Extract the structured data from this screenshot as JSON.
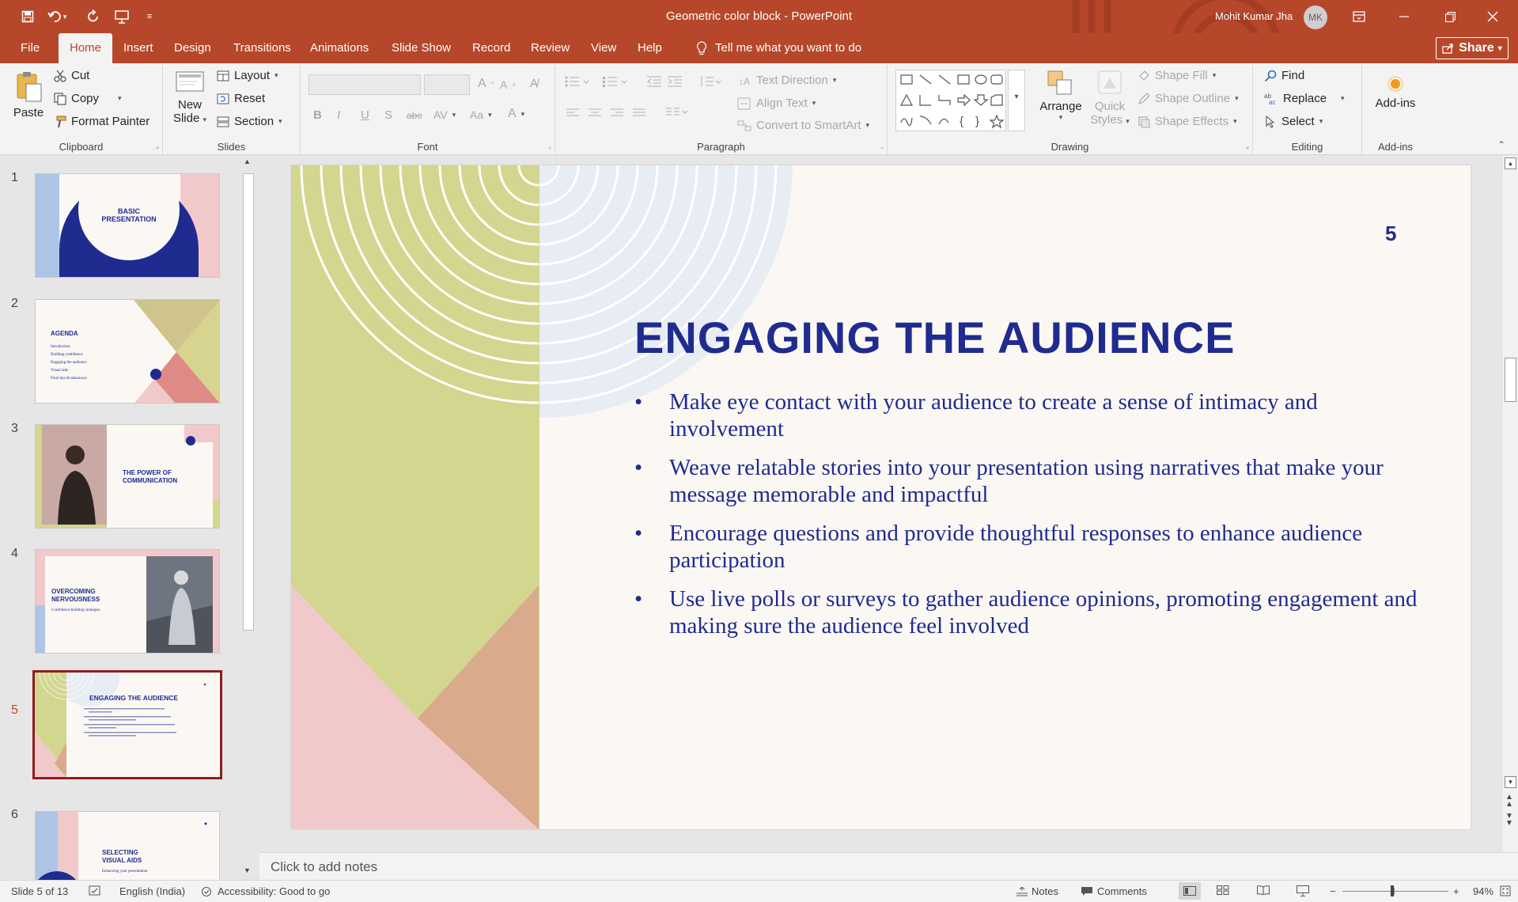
{
  "titlebar": {
    "title": "Geometric color block  -  PowerPoint",
    "user_name": "Mohit Kumar Jha",
    "user_initials": "MK",
    "qat": [
      "save-icon",
      "undo-icon",
      "redo-icon",
      "present-icon",
      "customize-icon"
    ],
    "window_controls": [
      "ribbon-display-icon",
      "minimize-icon",
      "restore-icon",
      "close-icon"
    ]
  },
  "tabs": [
    "File",
    "Home",
    "Insert",
    "Design",
    "Transitions",
    "Animations",
    "Slide Show",
    "Record",
    "Review",
    "View",
    "Help"
  ],
  "active_tab": "Home",
  "tell_me": "Tell me what you want to do",
  "share": "Share",
  "ribbon": {
    "clipboard": {
      "label": "Clipboard",
      "paste": "Paste",
      "cut": "Cut",
      "copy": "Copy",
      "format_painter": "Format Painter"
    },
    "slides": {
      "label": "Slides",
      "new_slide_1": "New",
      "new_slide_2": "Slide",
      "layout": "Layout",
      "reset": "Reset",
      "section": "Section"
    },
    "font": {
      "label": "Font"
    },
    "paragraph": {
      "label": "Paragraph",
      "text_direction": "Text Direction",
      "align_text": "Align Text",
      "convert_smartart": "Convert to SmartArt"
    },
    "drawing": {
      "label": "Drawing",
      "arrange": "Arrange",
      "quick_styles_1": "Quick",
      "quick_styles_2": "Styles",
      "shape_fill": "Shape Fill",
      "shape_outline": "Shape Outline",
      "shape_effects": "Shape Effects"
    },
    "editing": {
      "label": "Editing",
      "find": "Find",
      "replace": "Replace",
      "select": "Select"
    },
    "addins": {
      "label": "Add-ins",
      "addins": "Add-ins"
    }
  },
  "thumbnails": [
    {
      "num": "1",
      "title": "BASIC PRESENTATION",
      "title_1": "BASIC",
      "title_2": "PRESENTATION"
    },
    {
      "num": "2",
      "title": "AGENDA",
      "items": [
        "Introduction",
        "Building confidence",
        "Engaging the audience",
        "Visual aids",
        "Final tips & takeaways"
      ]
    },
    {
      "num": "3",
      "title": "THE POWER OF COMMUNICATION",
      "title_1": "THE POWER OF",
      "title_2": "COMMUNICATION"
    },
    {
      "num": "4",
      "title": "OVERCOMING NERVOUSNESS",
      "title_1": "OVERCOMING",
      "title_2": "NERVOUSNESS",
      "subtitle": "Confidence-building strategies"
    },
    {
      "num": "5",
      "title": "ENGAGING THE AUDIENCE"
    },
    {
      "num": "6",
      "title": "SELECTING VISUAL AIDS",
      "title_1": "SELECTING",
      "title_2": "VISUAL AIDS",
      "subtitle": "Enhancing your presentation"
    }
  ],
  "slide": {
    "number": "5",
    "title": "ENGAGING THE AUDIENCE",
    "bullets": [
      "Make eye contact with your audience to create a sense of intimacy and involvement",
      "Weave relatable stories into your presentation using narratives that make your message memorable and impactful",
      "Encourage questions and provide thoughtful responses to enhance audience participation",
      "Use live polls or surveys to gather audience opinions, promoting engagement and making sure the audience feel involved"
    ],
    "colors": {
      "title": "#1f2b8f",
      "green": "#d3d68f",
      "pink": "#f2c9cb",
      "tan": "#d9aa8b",
      "bg": "#fbf8f4",
      "circle": "#e8ecf3"
    }
  },
  "notes_placeholder": "Click to add notes",
  "status": {
    "slide_of": "Slide 5 of 13",
    "language": "English (India)",
    "accessibility": "Accessibility: Good to go",
    "notes": "Notes",
    "comments": "Comments",
    "zoom": "94%",
    "zoom_level": 0.94
  }
}
